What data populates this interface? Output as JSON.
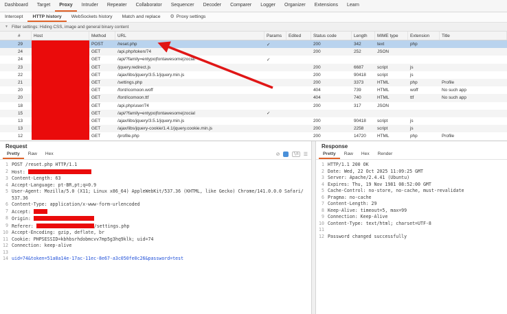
{
  "colors": {
    "accent": "#e06228",
    "redaction": "#ea0b0b",
    "selected_row": "#b9d3ee",
    "arrow": "#e01616"
  },
  "main_tabs": [
    {
      "label": "Dashboard"
    },
    {
      "label": "Target"
    },
    {
      "label": "Proxy",
      "selected": true
    },
    {
      "label": "Intruder"
    },
    {
      "label": "Repeater"
    },
    {
      "label": "Collaborator"
    },
    {
      "label": "Sequencer"
    },
    {
      "label": "Decoder"
    },
    {
      "label": "Comparer"
    },
    {
      "label": "Logger"
    },
    {
      "label": "Organizer"
    },
    {
      "label": "Extensions"
    },
    {
      "label": "Learn"
    }
  ],
  "sub_tabs": [
    {
      "label": "Intercept"
    },
    {
      "label": "HTTP history",
      "selected": true
    },
    {
      "label": "WebSockets history"
    },
    {
      "label": "Match and replace"
    },
    {
      "label": "Proxy settings",
      "icon": "gear"
    }
  ],
  "filter": {
    "text": "Filter settings: Hiding CSS, image and general binary content"
  },
  "table": {
    "columns": [
      "#",
      "Host",
      "Method",
      "URL",
      "Params",
      "Edited",
      "Status code",
      "Length",
      "MIME type",
      "Extension",
      "Title"
    ],
    "rows": [
      {
        "num": "29",
        "host_redacted": true,
        "method": "POST",
        "url": "/reset.php",
        "params": "✓",
        "edited": "",
        "status": "200",
        "length": "342",
        "mime": "text",
        "extension": "php",
        "title": "",
        "selected": true
      },
      {
        "num": "24",
        "host_redacted": true,
        "method": "GET",
        "url": "/api.php/token/74",
        "params": "",
        "edited": "",
        "status": "200",
        "length": "252",
        "mime": "JSON",
        "extension": "",
        "title": ""
      },
      {
        "num": "24",
        "host_redacted": true,
        "method": "GET",
        "url": "/api/?family=entypo|fontawesome|zocial",
        "params": "✓",
        "edited": "",
        "status": "",
        "length": "",
        "mime": "",
        "extension": "",
        "title": ""
      },
      {
        "num": "23",
        "host_redacted": true,
        "method": "GET",
        "url": "/jquery.redirect.js",
        "params": "",
        "edited": "",
        "status": "200",
        "length": "6687",
        "mime": "script",
        "extension": "js",
        "title": ""
      },
      {
        "num": "22",
        "host_redacted": true,
        "method": "GET",
        "url": "/ajax/libs/jquery/3.5.1/jquery.min.js",
        "params": "",
        "edited": "",
        "status": "200",
        "length": "90418",
        "mime": "script",
        "extension": "js",
        "title": ""
      },
      {
        "num": "21",
        "host_redacted": true,
        "method": "GET",
        "url": "/settings.php",
        "params": "",
        "edited": "",
        "status": "200",
        "length": "3373",
        "mime": "HTML",
        "extension": "php",
        "title": "Profile"
      },
      {
        "num": "20",
        "host_redacted": true,
        "method": "GET",
        "url": "/font/icomoon.woff",
        "params": "",
        "edited": "",
        "status": "404",
        "length": "739",
        "mime": "HTML",
        "extension": "woff",
        "title": "No such app"
      },
      {
        "num": "20",
        "host_redacted": true,
        "method": "GET",
        "url": "/font/icomoon.ttf",
        "params": "",
        "edited": "",
        "status": "404",
        "length": "740",
        "mime": "HTML",
        "extension": "ttf",
        "title": "No such app"
      },
      {
        "num": "18",
        "host_redacted": true,
        "method": "GET",
        "url": "/api.php/user/74",
        "params": "",
        "edited": "",
        "status": "200",
        "length": "317",
        "mime": "JSON",
        "extension": "",
        "title": ""
      },
      {
        "num": "15",
        "host_redacted": true,
        "method": "GET",
        "url": "/api/?family=entypo|fontawesome|zocial",
        "params": "✓",
        "edited": "",
        "status": "",
        "length": "",
        "mime": "",
        "extension": "",
        "title": ""
      },
      {
        "num": "13",
        "host_redacted": true,
        "method": "GET",
        "url": "/ajax/libs/jquery/3.5.1/jquery.min.js",
        "params": "",
        "edited": "",
        "status": "200",
        "length": "90418",
        "mime": "script",
        "extension": "js",
        "title": ""
      },
      {
        "num": "13",
        "host_redacted": true,
        "method": "GET",
        "url": "/ajax/libs/jquery-cookie/1.4.1/jquery.cookie.min.js",
        "params": "",
        "edited": "",
        "status": "200",
        "length": "2258",
        "mime": "script",
        "extension": "js",
        "title": ""
      },
      {
        "num": "12",
        "host_redacted": true,
        "method": "GET",
        "url": "/profile.php",
        "params": "",
        "edited": "",
        "status": "200",
        "length": "14720",
        "mime": "HTML",
        "extension": "php",
        "title": "Profile"
      }
    ]
  },
  "request": {
    "title": "Request",
    "tabs": [
      {
        "label": "Pretty",
        "selected": true
      },
      {
        "label": "Raw"
      },
      {
        "label": "Hex"
      }
    ],
    "toolbar_icons": [
      "cancel",
      "inspector",
      "newline",
      "menu"
    ],
    "lines": [
      {
        "n": "1",
        "segs": [
          {
            "t": "POST /reset.php HTTP/1.1"
          }
        ]
      },
      {
        "n": "2",
        "segs": [
          {
            "t": "Host: "
          },
          {
            "r": 23
          }
        ]
      },
      {
        "n": "3",
        "segs": [
          {
            "t": "Content-Length: 63"
          }
        ]
      },
      {
        "n": "4",
        "segs": [
          {
            "t": "Accept-Language: pt-BR,pt;q=0.9"
          }
        ]
      },
      {
        "n": "5",
        "segs": [
          {
            "t": "User-Agent: Mozilla/5.0 (X11; Linux x86_64) AppleWebKit/537.36 (KHTML, like Gecko) Chrome/141.0.0.0 Safari/537.36"
          }
        ]
      },
      {
        "n": "6",
        "segs": [
          {
            "t": "Content-Type: application/x-www-form-urlencoded"
          }
        ]
      },
      {
        "n": "7",
        "segs": [
          {
            "t": "Accept: "
          },
          {
            "r": 5
          }
        ]
      },
      {
        "n": "8",
        "segs": [
          {
            "t": "Origin: "
          },
          {
            "r": 22
          }
        ]
      },
      {
        "n": "9",
        "segs": [
          {
            "t": "Referer: "
          },
          {
            "r": 21
          },
          {
            "t": "/settings.php"
          }
        ]
      },
      {
        "n": "10",
        "segs": [
          {
            "t": "Accept-Encoding: gzip, deflate, br"
          }
        ]
      },
      {
        "n": "11",
        "segs": [
          {
            "t": "Cookie: PHPSESSID=kbhbsrhdobmcvv7mp5g3hq9klk; uid=74"
          }
        ]
      },
      {
        "n": "12",
        "segs": [
          {
            "t": "Connection: keep-alive"
          }
        ]
      },
      {
        "n": "13",
        "segs": []
      },
      {
        "n": "14",
        "segs": [
          {
            "t": "uid=74&token=51a8a14e-17ac-11ec-8e67-a3c050fe0c26&password=test",
            "c": "blue"
          }
        ]
      }
    ]
  },
  "response": {
    "title": "Response",
    "tabs": [
      {
        "label": "Pretty",
        "selected": true
      },
      {
        "label": "Raw"
      },
      {
        "label": "Hex"
      },
      {
        "label": "Render"
      }
    ],
    "lines": [
      {
        "n": "1",
        "segs": [
          {
            "t": "HTTP/1.1 200 OK"
          }
        ]
      },
      {
        "n": "2",
        "segs": [
          {
            "t": "Date: Wed, 22 Oct 2025 11:09:25 GMT"
          }
        ]
      },
      {
        "n": "3",
        "segs": [
          {
            "t": "Server: Apache/2.4.41 (Ubuntu)"
          }
        ]
      },
      {
        "n": "4",
        "segs": [
          {
            "t": "Expires: Thu, 19 Nov 1981 08:52:00 GMT"
          }
        ]
      },
      {
        "n": "5",
        "segs": [
          {
            "t": "Cache-Control: no-store, no-cache, must-revalidate"
          }
        ]
      },
      {
        "n": "6",
        "segs": [
          {
            "t": "Pragma: no-cache"
          }
        ]
      },
      {
        "n": "7",
        "segs": [
          {
            "t": "Content-Length: 29"
          }
        ]
      },
      {
        "n": "8",
        "segs": [
          {
            "t": "Keep-Alive: timeout=5, max=99"
          }
        ]
      },
      {
        "n": "9",
        "segs": [
          {
            "t": "Connection: Keep-Alive"
          }
        ]
      },
      {
        "n": "10",
        "segs": [
          {
            "t": "Content-Type: text/html; charset=UTF-8"
          }
        ]
      },
      {
        "n": "11",
        "segs": []
      },
      {
        "n": "12",
        "segs": [
          {
            "t": "Password changed successfully"
          }
        ]
      }
    ]
  }
}
